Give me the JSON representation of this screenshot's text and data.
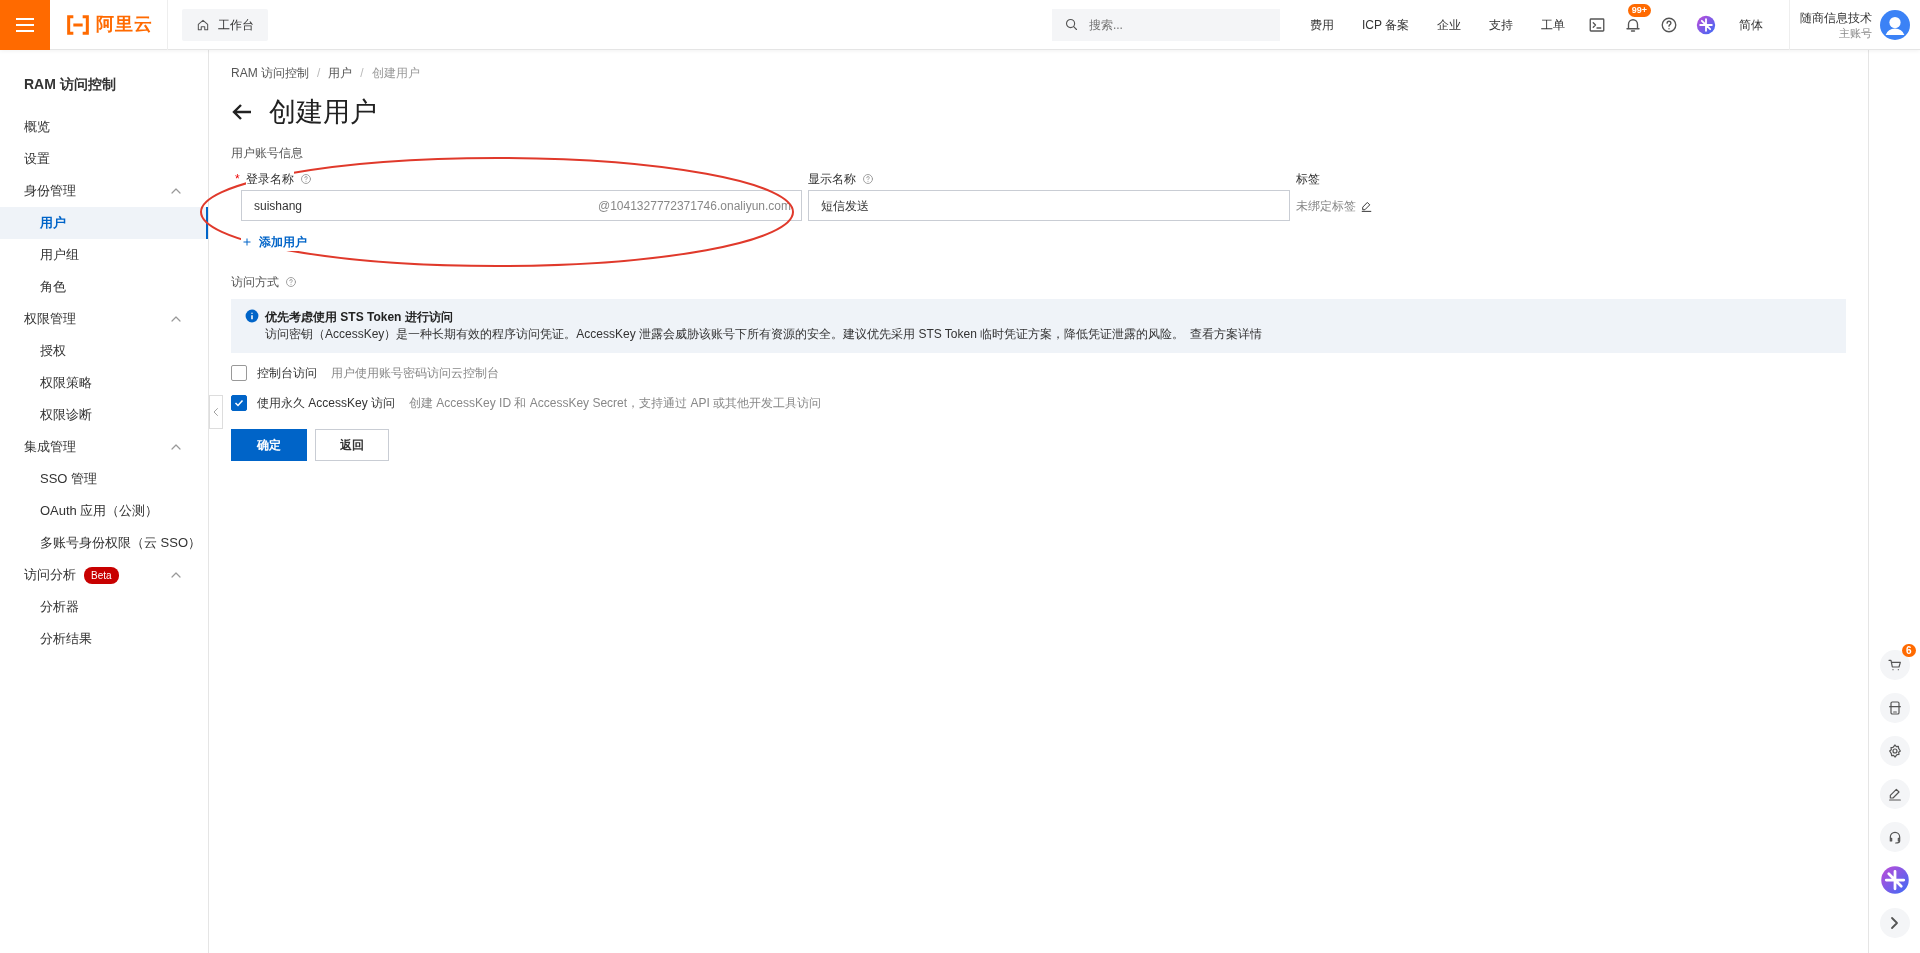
{
  "topbar": {
    "logo_text": "阿里云",
    "workbench": "工作台",
    "search": {
      "placeholder": "搜索..."
    },
    "links": [
      "费用",
      "ICP 备案",
      "企业",
      "支持",
      "工单"
    ],
    "icon_buttons": [
      {
        "kind": "terminal"
      },
      {
        "kind": "bell",
        "badge": "99+"
      },
      {
        "kind": "help"
      },
      {
        "kind": "assistant"
      }
    ],
    "language": "简体",
    "account": {
      "name": "随商信息技术",
      "role": "主账号"
    }
  },
  "sidebar": {
    "title": "RAM 访问控制",
    "items": [
      {
        "label": "概览",
        "selected": false
      },
      {
        "label": "设置",
        "selected": false
      },
      {
        "label": "身份管理",
        "selected": false,
        "expanded": true,
        "children": [
          {
            "label": "用户",
            "selected": true
          },
          {
            "label": "用户组",
            "selected": false
          },
          {
            "label": "角色",
            "selected": false
          }
        ]
      },
      {
        "label": "权限管理",
        "selected": false,
        "expanded": true,
        "children": [
          {
            "label": "授权",
            "selected": false
          },
          {
            "label": "权限策略",
            "selected": false
          },
          {
            "label": "权限诊断",
            "selected": false
          }
        ]
      },
      {
        "label": "集成管理",
        "selected": false,
        "expanded": true,
        "children": [
          {
            "label": "SSO 管理",
            "selected": false
          },
          {
            "label": "OAuth 应用（公测）",
            "selected": false
          },
          {
            "label": "多账号身份权限（云 SSO）",
            "selected": false
          }
        ]
      },
      {
        "label": "访问分析",
        "badge": "Beta",
        "selected": false,
        "expanded": true,
        "children": [
          {
            "label": "分析器",
            "selected": false
          },
          {
            "label": "分析结果",
            "selected": false
          }
        ]
      }
    ]
  },
  "breadcrumb": [
    {
      "label": "RAM 访问控制",
      "separator": "/"
    },
    {
      "label": "用户",
      "separator": "/"
    },
    {
      "label": "创建用户"
    }
  ],
  "title": "创建用户",
  "section_label": "用户账号信息",
  "fields": {
    "login": {
      "required_mark": "*",
      "label": "登录名称",
      "value": "suishang",
      "suffix": "@1041327772371746.onaliyun.com"
    },
    "display": {
      "label": "显示名称",
      "value": "短信发送"
    },
    "tags": {
      "label": "标签",
      "value": "未绑定标签"
    }
  },
  "add_user": "添加用户",
  "access_label": "访问方式",
  "alert": {
    "title": "优先考虑使用 STS Token 进行访问",
    "text": "访问密钥（AccessKey）是一种长期有效的程序访问凭证。AccessKey 泄露会威胁该账号下所有资源的安全。建议优先采用 STS Token 临时凭证方案，降低凭证泄露的风险。",
    "link": "查看方案详情"
  },
  "access_options": [
    {
      "label": "控制台访问",
      "description": "用户使用账号密码访问云控制台",
      "checked": false
    },
    {
      "label": "使用永久 AccessKey 访问",
      "description": "创建 AccessKey ID 和 AccessKey Secret，支持通过 API 或其他开发工具访问",
      "checked": true
    }
  ],
  "buttons": [
    {
      "label": "确定",
      "kind": "primary"
    },
    {
      "label": "返回",
      "kind": "secondary"
    }
  ],
  "right_rail": [
    {
      "kind": "cart",
      "badge": "6"
    },
    {
      "kind": "app"
    },
    {
      "kind": "settings"
    },
    {
      "kind": "edit"
    },
    {
      "kind": "headset"
    },
    {
      "kind": "assistant"
    },
    {
      "kind": "expand"
    }
  ]
}
